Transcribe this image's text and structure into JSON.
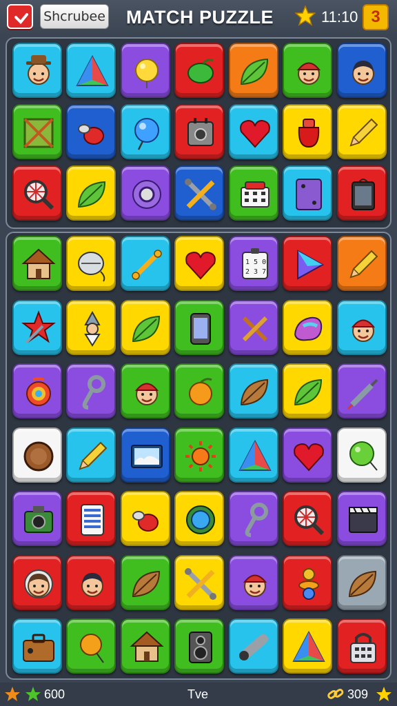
{
  "header": {
    "game_name": "Shcrubee",
    "title": "MATCH PUZZLE",
    "time": "11:10",
    "level": "3"
  },
  "footer": {
    "coins": "600",
    "center_label": "Tve",
    "links": "309"
  },
  "colors": {
    "cyan": "#27c3ec",
    "purple": "#8a4de0",
    "red": "#e22222",
    "orange": "#f47b16",
    "green": "#41be1f",
    "blue": "#1f5fd0",
    "yellow": "#ffd800",
    "white": "#f6f6f6",
    "gray": "#9aa8b4"
  },
  "board_top": [
    [
      {
        "color": "cyan",
        "icon": "cowboy-face"
      },
      {
        "color": "cyan",
        "icon": "triangle"
      },
      {
        "color": "purple",
        "icon": "yellow-ball"
      },
      {
        "color": "red",
        "icon": "green-fruit"
      },
      {
        "color": "orange",
        "icon": "leaf"
      },
      {
        "color": "green",
        "icon": "cap-face"
      },
      {
        "color": "blue",
        "icon": "boy-face"
      }
    ],
    [
      {
        "color": "green",
        "icon": "crate"
      },
      {
        "color": "blue",
        "icon": "red-creature"
      },
      {
        "color": "cyan",
        "icon": "blue-ball"
      },
      {
        "color": "red",
        "icon": "gadget"
      },
      {
        "color": "cyan",
        "icon": "heart"
      },
      {
        "color": "yellow",
        "icon": "red-bag"
      },
      {
        "color": "yellow",
        "icon": "pencil"
      }
    ],
    [
      {
        "color": "red",
        "icon": "magnifier"
      },
      {
        "color": "yellow",
        "icon": "leaf"
      },
      {
        "color": "purple",
        "icon": "disc"
      },
      {
        "color": "blue",
        "icon": "crossed-tools"
      },
      {
        "color": "green",
        "icon": "register"
      },
      {
        "color": "cyan",
        "icon": "card"
      },
      {
        "color": "red",
        "icon": "tablet"
      }
    ]
  ],
  "board_bottom": [
    [
      {
        "color": "green",
        "icon": "hut"
      },
      {
        "color": "yellow",
        "icon": "mouse"
      },
      {
        "color": "cyan",
        "icon": "bone"
      },
      {
        "color": "yellow",
        "icon": "heart"
      },
      {
        "color": "purple",
        "icon": "calculator"
      },
      {
        "color": "red",
        "icon": "play-triangle"
      },
      {
        "color": "orange",
        "icon": "pencil"
      }
    ],
    [
      {
        "color": "cyan",
        "icon": "red-star"
      },
      {
        "color": "yellow",
        "icon": "gnome"
      },
      {
        "color": "yellow",
        "icon": "leaf"
      },
      {
        "color": "green",
        "icon": "phone"
      },
      {
        "color": "purple",
        "icon": "crossed-sticks"
      },
      {
        "color": "yellow",
        "icon": "paint-blob"
      },
      {
        "color": "cyan",
        "icon": "cap-face"
      }
    ],
    [
      {
        "color": "purple",
        "icon": "lollipop"
      },
      {
        "color": "purple",
        "icon": "hook"
      },
      {
        "color": "green",
        "icon": "cap-face"
      },
      {
        "color": "green",
        "icon": "orange-fruit"
      },
      {
        "color": "cyan",
        "icon": "brown-leaf"
      },
      {
        "color": "yellow",
        "icon": "leaf"
      },
      {
        "color": "purple",
        "icon": "syringe"
      }
    ],
    [
      {
        "color": "white",
        "icon": "cookie"
      },
      {
        "color": "cyan",
        "icon": "pencil"
      },
      {
        "color": "blue",
        "icon": "picture"
      },
      {
        "color": "green",
        "icon": "sun"
      },
      {
        "color": "cyan",
        "icon": "triangle"
      },
      {
        "color": "purple",
        "icon": "heart"
      },
      {
        "color": "white",
        "icon": "green-balloon"
      }
    ],
    [
      {
        "color": "purple",
        "icon": "camera"
      },
      {
        "color": "red",
        "icon": "phone-list"
      },
      {
        "color": "yellow",
        "icon": "red-creature"
      },
      {
        "color": "yellow",
        "icon": "blue-gear"
      },
      {
        "color": "purple",
        "icon": "hook"
      },
      {
        "color": "red",
        "icon": "magnifier"
      },
      {
        "color": "purple",
        "icon": "clapper"
      }
    ],
    [
      {
        "color": "red",
        "icon": "girl-face"
      },
      {
        "color": "red",
        "icon": "boy-face"
      },
      {
        "color": "green",
        "icon": "brown-leaf"
      },
      {
        "color": "yellow",
        "icon": "crossed-tools"
      },
      {
        "color": "purple",
        "icon": "cap-face"
      },
      {
        "color": "red",
        "icon": "pacifier"
      },
      {
        "color": "gray",
        "icon": "brown-leaf"
      }
    ],
    [
      {
        "color": "cyan",
        "icon": "suitcase"
      },
      {
        "color": "green",
        "icon": "orange-balloon"
      },
      {
        "color": "green",
        "icon": "hut"
      },
      {
        "color": "green",
        "icon": "speaker"
      },
      {
        "color": "cyan",
        "icon": "pipe"
      },
      {
        "color": "yellow",
        "icon": "triangle"
      },
      {
        "color": "red",
        "icon": "lock"
      }
    ]
  ]
}
